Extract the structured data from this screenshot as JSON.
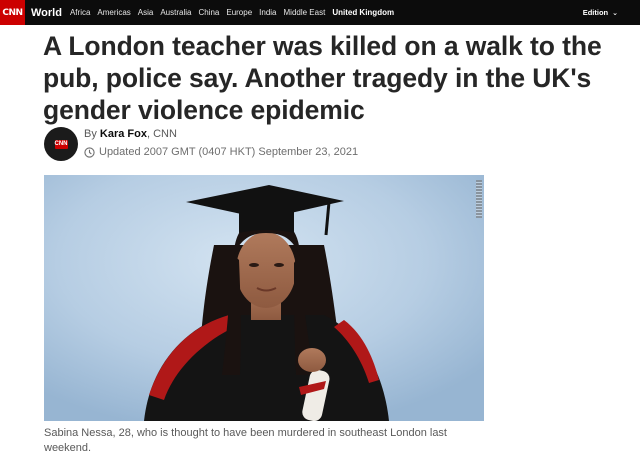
{
  "nav": {
    "logo": "CNN",
    "section": "World",
    "links": [
      "Africa",
      "Americas",
      "Asia",
      "Australia",
      "China",
      "Europe",
      "India",
      "Middle East",
      "United Kingdom"
    ],
    "edition": "Edition"
  },
  "article": {
    "headline": "A London teacher was killed on a walk to the pub, police say. Another tragedy in the UK's gender violence epidemic",
    "byline_prefix": "By ",
    "author": "Kara Fox",
    "byline_suffix": ", CNN",
    "updated": "Updated 2007 GMT (0407 HKT) September 23, 2021",
    "avatar_text": "CNN",
    "caption": "Sabina Nessa, 28, who is thought to have been murdered in southeast London last weekend."
  },
  "colors": {
    "nav_bg": "#0c0c0c",
    "brand_red": "#cc0000",
    "headline": "#262626",
    "muted": "#595959"
  }
}
